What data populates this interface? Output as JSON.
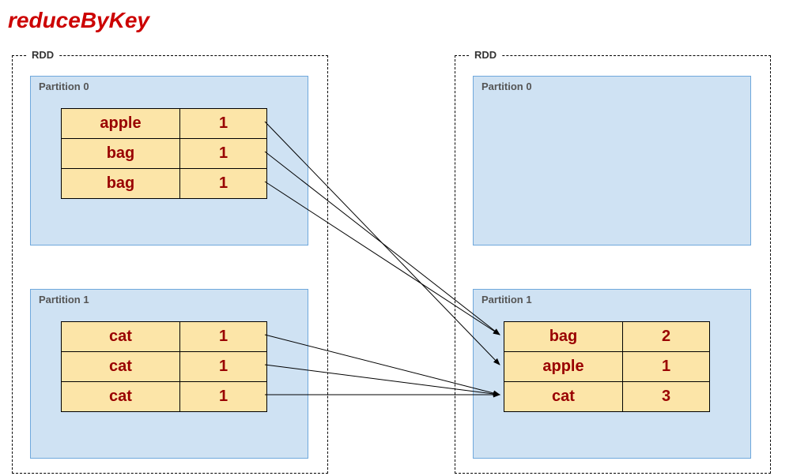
{
  "title": "reduceByKey",
  "rdd_label": "RDD",
  "left_rdd": {
    "partition0": {
      "label": "Partition 0",
      "rows": [
        {
          "key": "apple",
          "value": "1"
        },
        {
          "key": "bag",
          "value": "1"
        },
        {
          "key": "bag",
          "value": "1"
        }
      ]
    },
    "partition1": {
      "label": "Partition 1",
      "rows": [
        {
          "key": "cat",
          "value": "1"
        },
        {
          "key": "cat",
          "value": "1"
        },
        {
          "key": "cat",
          "value": "1"
        }
      ]
    }
  },
  "right_rdd": {
    "partition0": {
      "label": "Partition 0",
      "rows": []
    },
    "partition1": {
      "label": "Partition 1",
      "rows": [
        {
          "key": "bag",
          "value": "2"
        },
        {
          "key": "apple",
          "value": "1"
        },
        {
          "key": "cat",
          "value": "3"
        }
      ]
    }
  }
}
